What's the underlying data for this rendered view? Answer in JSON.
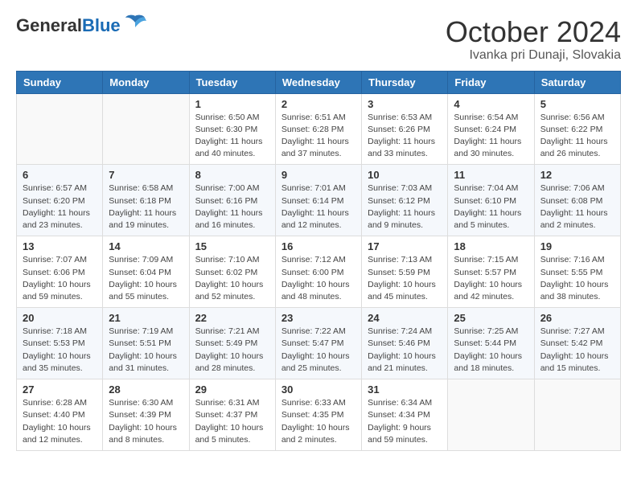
{
  "header": {
    "logo": {
      "general": "General",
      "blue": "Blue"
    },
    "month": "October 2024",
    "location": "Ivanka pri Dunaji, Slovakia"
  },
  "weekdays": [
    "Sunday",
    "Monday",
    "Tuesday",
    "Wednesday",
    "Thursday",
    "Friday",
    "Saturday"
  ],
  "weeks": [
    [
      {
        "day": "",
        "sunrise": "",
        "sunset": "",
        "daylight": ""
      },
      {
        "day": "",
        "sunrise": "",
        "sunset": "",
        "daylight": ""
      },
      {
        "day": "1",
        "sunrise": "Sunrise: 6:50 AM",
        "sunset": "Sunset: 6:30 PM",
        "daylight": "Daylight: 11 hours and 40 minutes."
      },
      {
        "day": "2",
        "sunrise": "Sunrise: 6:51 AM",
        "sunset": "Sunset: 6:28 PM",
        "daylight": "Daylight: 11 hours and 37 minutes."
      },
      {
        "day": "3",
        "sunrise": "Sunrise: 6:53 AM",
        "sunset": "Sunset: 6:26 PM",
        "daylight": "Daylight: 11 hours and 33 minutes."
      },
      {
        "day": "4",
        "sunrise": "Sunrise: 6:54 AM",
        "sunset": "Sunset: 6:24 PM",
        "daylight": "Daylight: 11 hours and 30 minutes."
      },
      {
        "day": "5",
        "sunrise": "Sunrise: 6:56 AM",
        "sunset": "Sunset: 6:22 PM",
        "daylight": "Daylight: 11 hours and 26 minutes."
      }
    ],
    [
      {
        "day": "6",
        "sunrise": "Sunrise: 6:57 AM",
        "sunset": "Sunset: 6:20 PM",
        "daylight": "Daylight: 11 hours and 23 minutes."
      },
      {
        "day": "7",
        "sunrise": "Sunrise: 6:58 AM",
        "sunset": "Sunset: 6:18 PM",
        "daylight": "Daylight: 11 hours and 19 minutes."
      },
      {
        "day": "8",
        "sunrise": "Sunrise: 7:00 AM",
        "sunset": "Sunset: 6:16 PM",
        "daylight": "Daylight: 11 hours and 16 minutes."
      },
      {
        "day": "9",
        "sunrise": "Sunrise: 7:01 AM",
        "sunset": "Sunset: 6:14 PM",
        "daylight": "Daylight: 11 hours and 12 minutes."
      },
      {
        "day": "10",
        "sunrise": "Sunrise: 7:03 AM",
        "sunset": "Sunset: 6:12 PM",
        "daylight": "Daylight: 11 hours and 9 minutes."
      },
      {
        "day": "11",
        "sunrise": "Sunrise: 7:04 AM",
        "sunset": "Sunset: 6:10 PM",
        "daylight": "Daylight: 11 hours and 5 minutes."
      },
      {
        "day": "12",
        "sunrise": "Sunrise: 7:06 AM",
        "sunset": "Sunset: 6:08 PM",
        "daylight": "Daylight: 11 hours and 2 minutes."
      }
    ],
    [
      {
        "day": "13",
        "sunrise": "Sunrise: 7:07 AM",
        "sunset": "Sunset: 6:06 PM",
        "daylight": "Daylight: 10 hours and 59 minutes."
      },
      {
        "day": "14",
        "sunrise": "Sunrise: 7:09 AM",
        "sunset": "Sunset: 6:04 PM",
        "daylight": "Daylight: 10 hours and 55 minutes."
      },
      {
        "day": "15",
        "sunrise": "Sunrise: 7:10 AM",
        "sunset": "Sunset: 6:02 PM",
        "daylight": "Daylight: 10 hours and 52 minutes."
      },
      {
        "day": "16",
        "sunrise": "Sunrise: 7:12 AM",
        "sunset": "Sunset: 6:00 PM",
        "daylight": "Daylight: 10 hours and 48 minutes."
      },
      {
        "day": "17",
        "sunrise": "Sunrise: 7:13 AM",
        "sunset": "Sunset: 5:59 PM",
        "daylight": "Daylight: 10 hours and 45 minutes."
      },
      {
        "day": "18",
        "sunrise": "Sunrise: 7:15 AM",
        "sunset": "Sunset: 5:57 PM",
        "daylight": "Daylight: 10 hours and 42 minutes."
      },
      {
        "day": "19",
        "sunrise": "Sunrise: 7:16 AM",
        "sunset": "Sunset: 5:55 PM",
        "daylight": "Daylight: 10 hours and 38 minutes."
      }
    ],
    [
      {
        "day": "20",
        "sunrise": "Sunrise: 7:18 AM",
        "sunset": "Sunset: 5:53 PM",
        "daylight": "Daylight: 10 hours and 35 minutes."
      },
      {
        "day": "21",
        "sunrise": "Sunrise: 7:19 AM",
        "sunset": "Sunset: 5:51 PM",
        "daylight": "Daylight: 10 hours and 31 minutes."
      },
      {
        "day": "22",
        "sunrise": "Sunrise: 7:21 AM",
        "sunset": "Sunset: 5:49 PM",
        "daylight": "Daylight: 10 hours and 28 minutes."
      },
      {
        "day": "23",
        "sunrise": "Sunrise: 7:22 AM",
        "sunset": "Sunset: 5:47 PM",
        "daylight": "Daylight: 10 hours and 25 minutes."
      },
      {
        "day": "24",
        "sunrise": "Sunrise: 7:24 AM",
        "sunset": "Sunset: 5:46 PM",
        "daylight": "Daylight: 10 hours and 21 minutes."
      },
      {
        "day": "25",
        "sunrise": "Sunrise: 7:25 AM",
        "sunset": "Sunset: 5:44 PM",
        "daylight": "Daylight: 10 hours and 18 minutes."
      },
      {
        "day": "26",
        "sunrise": "Sunrise: 7:27 AM",
        "sunset": "Sunset: 5:42 PM",
        "daylight": "Daylight: 10 hours and 15 minutes."
      }
    ],
    [
      {
        "day": "27",
        "sunrise": "Sunrise: 6:28 AM",
        "sunset": "Sunset: 4:40 PM",
        "daylight": "Daylight: 10 hours and 12 minutes."
      },
      {
        "day": "28",
        "sunrise": "Sunrise: 6:30 AM",
        "sunset": "Sunset: 4:39 PM",
        "daylight": "Daylight: 10 hours and 8 minutes."
      },
      {
        "day": "29",
        "sunrise": "Sunrise: 6:31 AM",
        "sunset": "Sunset: 4:37 PM",
        "daylight": "Daylight: 10 hours and 5 minutes."
      },
      {
        "day": "30",
        "sunrise": "Sunrise: 6:33 AM",
        "sunset": "Sunset: 4:35 PM",
        "daylight": "Daylight: 10 hours and 2 minutes."
      },
      {
        "day": "31",
        "sunrise": "Sunrise: 6:34 AM",
        "sunset": "Sunset: 4:34 PM",
        "daylight": "Daylight: 9 hours and 59 minutes."
      },
      {
        "day": "",
        "sunrise": "",
        "sunset": "",
        "daylight": ""
      },
      {
        "day": "",
        "sunrise": "",
        "sunset": "",
        "daylight": ""
      }
    ]
  ]
}
